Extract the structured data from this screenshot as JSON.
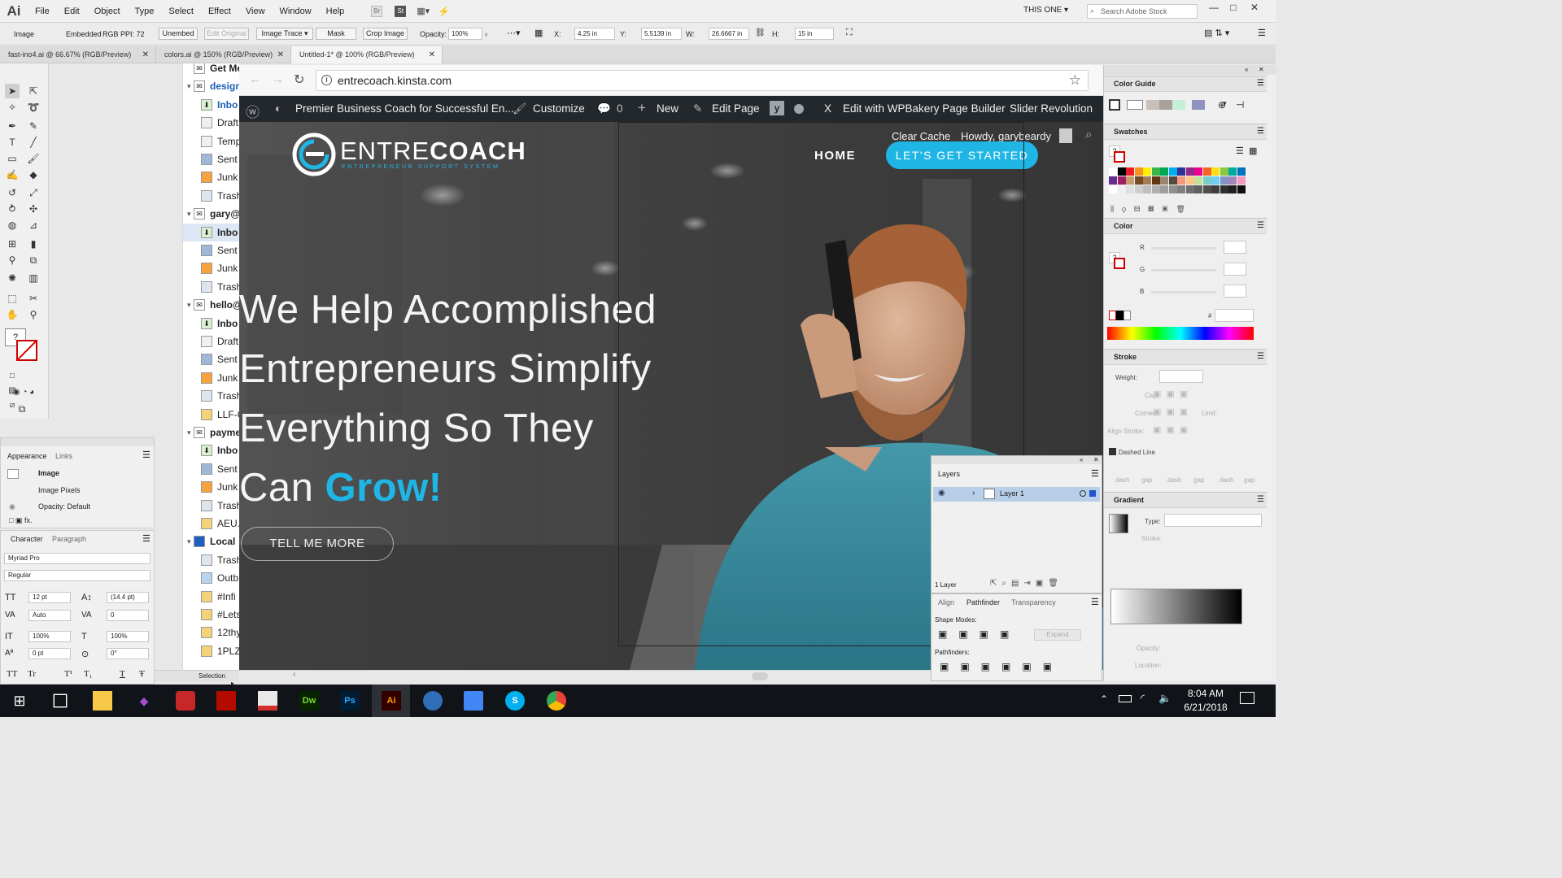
{
  "app": {
    "logo": "Ai"
  },
  "menu": [
    "File",
    "Edit",
    "Object",
    "Type",
    "Select",
    "Effect",
    "View",
    "Window",
    "Help"
  ],
  "menu_icons": {
    "bridge": "Br",
    "stock": "St"
  },
  "workspace": {
    "label": "THIS ONE",
    "search_placeholder": "Search Adobe Stock"
  },
  "control_bar": {
    "image": "Image",
    "embedded": "Embedded",
    "rgb": "RGB",
    "ppi": "PPI: 72",
    "unembed": "Unembed",
    "edit_original": "Edit Original",
    "image_trace": "Image Trace",
    "mask": "Mask",
    "crop_image": "Crop Image",
    "opacity_label": "Opacity:",
    "opacity_value": "100%",
    "x_label": "X:",
    "x_value": "4.25 in",
    "y_label": "Y:",
    "y_value": "5.5139 in",
    "w_label": "W:",
    "w_value": "26.6667 in",
    "h_label": "H:",
    "h_value": "15 in"
  },
  "doc_tabs": [
    {
      "label": "fast-ino4.ai @ 66.67% (RGB/Preview)"
    },
    {
      "label": "colors.ai @ 150% (RGB/Preview)"
    },
    {
      "label": "Untitled-1* @ 100% (RGB/Preview)"
    }
  ],
  "appearance": {
    "tab1": "Appearance",
    "tab2": "Links",
    "item": "Image",
    "pixels": "Image Pixels",
    "opacity_label": "Opacity:",
    "opacity_value": "Default",
    "fx": "fx."
  },
  "character": {
    "tab1": "Character",
    "tab2": "Paragraph",
    "font": "Myriad Pro",
    "style": "Regular",
    "size": "12 pt",
    "leading": "(14.4 pt)",
    "kerning": "Auto",
    "tracking": "0",
    "vscale": "100%",
    "hscale": "100%",
    "baseline": "0 pt",
    "rotate": "0°",
    "bottom": [
      "TT",
      "Tr",
      "T¹",
      "T₁",
      "T",
      "Ŧ"
    ]
  },
  "status_bar": {
    "selection": "Selection"
  },
  "mail_list": [
    {
      "label": "Get Me",
      "kind": "header"
    },
    {
      "label": "design",
      "kind": "acct-blue"
    },
    {
      "label": "Inbo",
      "kind": "inbox-blue"
    },
    {
      "label": "Draft",
      "kind": "draft"
    },
    {
      "label": "Temp",
      "kind": "draft"
    },
    {
      "label": "Sent",
      "kind": "sent"
    },
    {
      "label": "Junk",
      "kind": "junk"
    },
    {
      "label": "Trash",
      "kind": "trash"
    },
    {
      "label": "gary@",
      "kind": "acct"
    },
    {
      "label": "Inbo",
      "kind": "inbox-sel"
    },
    {
      "label": "Sent",
      "kind": "sent"
    },
    {
      "label": "Junk",
      "kind": "junk"
    },
    {
      "label": "Trash",
      "kind": "trash"
    },
    {
      "label": "hello@",
      "kind": "acct"
    },
    {
      "label": "Inbo",
      "kind": "inbox"
    },
    {
      "label": "Draft",
      "kind": "draft"
    },
    {
      "label": "Sent",
      "kind": "sent"
    },
    {
      "label": "Junk",
      "kind": "junk"
    },
    {
      "label": "Trash",
      "kind": "trash"
    },
    {
      "label": "LLF-C",
      "kind": "folder"
    },
    {
      "label": "payme",
      "kind": "acct"
    },
    {
      "label": "Inbo",
      "kind": "inbox"
    },
    {
      "label": "Sent",
      "kind": "sent"
    },
    {
      "label": "Junk",
      "kind": "junk"
    },
    {
      "label": "Trash",
      "kind": "trash"
    },
    {
      "label": "AEU.c",
      "kind": "folder"
    },
    {
      "label": "Local",
      "kind": "acct-local"
    },
    {
      "label": "Trash",
      "kind": "trash"
    },
    {
      "label": "Outb",
      "kind": "outbox"
    },
    {
      "label": "#Infi",
      "kind": "folder"
    },
    {
      "label": "#Lets",
      "kind": "folder"
    },
    {
      "label": "12thy",
      "kind": "folder"
    },
    {
      "label": "1PLZ",
      "kind": "folder"
    }
  ],
  "browser": {
    "url": "entrecoach.kinsta.com"
  },
  "wp_admin_bar": {
    "site_title": "Premier Business Coach for Successful En...",
    "customize": "Customize",
    "comments": "0",
    "new": "New",
    "edit_page": "Edit Page",
    "close_x": "X",
    "wpbakery": "Edit with WPBakery Page Builder",
    "slider": "Slider Revolution"
  },
  "site": {
    "logo_light": "ENTRE",
    "logo_bold": "COACH",
    "tagline": "ENTREPRENEUR SUPPORT SYSTEM",
    "clear_cache": "Clear Cache",
    "howdy": "Howdy, garybeardy",
    "nav_home": "HOME",
    "nav_cta": "LET'S GET STARTED",
    "hero_line1": "We Help Accomplished",
    "hero_line2": "Entrepreneurs Simplify",
    "hero_line3": "Everything So They",
    "hero_line4_a": "Can ",
    "hero_line4_b": "Grow!",
    "hero_button": "TELL ME MORE",
    "accent_color": "#1fb6e6"
  },
  "layers": {
    "title": "Layers",
    "layer_name": "Layer 1",
    "count": "1 Layer"
  },
  "align_panel": {
    "tab1": "Align",
    "tab2": "Pathfinder",
    "tab3": "Transparency",
    "shape_modes": "Shape Modes:",
    "expand": "Expand",
    "pathfinders": "Pathfinders:"
  },
  "right_panels": {
    "color_guide": "Color Guide",
    "swatches": "Swatches",
    "color": "Color",
    "r": "R",
    "g": "G",
    "b": "B",
    "hash": "#",
    "stroke": "Stroke",
    "weight": "Weight:",
    "cap": "Cap:",
    "corner": "Corner:",
    "limit": "Limit:",
    "align_stroke": "Align Stroke:",
    "dashed_line": "Dashed Line",
    "dash_labels": [
      "dash",
      "gap",
      "dash",
      "gap",
      "dash",
      "gap"
    ],
    "gradient": "Gradient",
    "type": "Type:",
    "stroke_lbl": "Stroke:",
    "opacity": "Opacity:",
    "location": "Location:"
  },
  "swatch_colors": [
    "#ffffff",
    "#000000",
    "#ed1c24",
    "#f7941d",
    "#fff200",
    "#39b54a",
    "#00a651",
    "#00aeef",
    "#2e3192",
    "#92278f",
    "#ec008c",
    "#f26522",
    "#ffde17",
    "#8dc63f",
    "#00a99d",
    "#0072bc",
    "#662d91",
    "#9e1f63",
    "#c69c6d",
    "#754c24",
    "#a67c52",
    "#603913",
    "#998675",
    "#534741",
    "#f7977a",
    "#fdc68a",
    "#c4df9b",
    "#7accc8",
    "#6dcff6",
    "#8393ca",
    "#a187be",
    "#f49ac1"
  ],
  "clock": {
    "time": "8:04 AM",
    "date": "6/21/2018"
  },
  "taskbar_apps": [
    "windows",
    "task-view",
    "file-explorer",
    "visual-studio",
    "lastpass",
    "acrobat",
    "pdf",
    "dreamweaver",
    "photoshop",
    "illustrator",
    "thunderbird",
    "docs",
    "skype",
    "chrome"
  ]
}
